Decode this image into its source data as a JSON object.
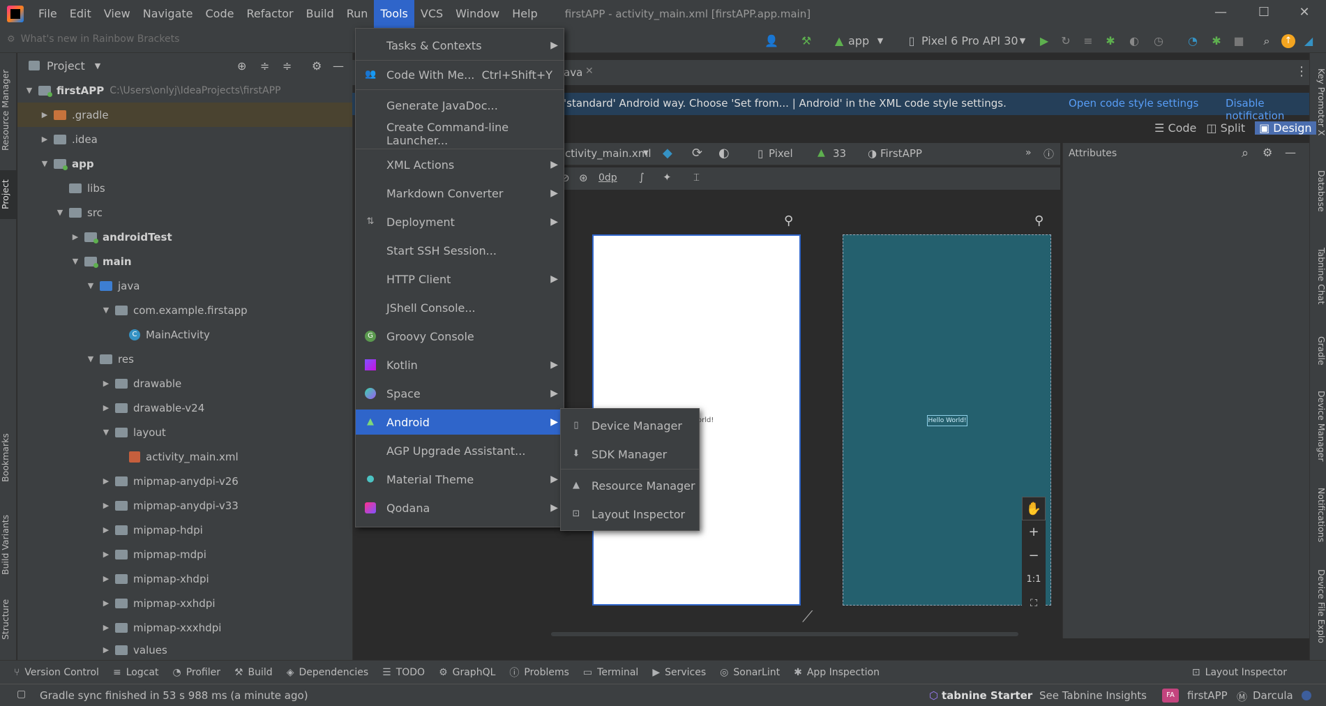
{
  "window": {
    "title": "firstAPP - activity_main.xml [firstAPP.app.main]",
    "minimize": "—",
    "maximize": "☐",
    "close": "✕"
  },
  "menubar": [
    "File",
    "Edit",
    "View",
    "Navigate",
    "Code",
    "Refactor",
    "Build",
    "Run",
    "Tools",
    "VCS",
    "Window",
    "Help"
  ],
  "navbar": {
    "whats_new": "What's new in Rainbow Brackets",
    "run_config": "app",
    "device": "Pixel 6 Pro API 30"
  },
  "left_stripe": [
    "Resource Manager",
    "Project",
    "Bookmarks",
    "Build Variants",
    "Structure"
  ],
  "right_stripe": [
    "Key Promoter X",
    "Database",
    "Tabnine Chat",
    "Gradle",
    "Device Manager",
    "Notifications",
    "Device File Explo"
  ],
  "project_panel": {
    "title": "Project",
    "tree": [
      {
        "label": "firstAPP",
        "extra": "C:\\Users\\onlyj\\IdeaProjects\\firstAPP",
        "bold": true
      },
      {
        "label": ".gradle"
      },
      {
        "label": ".idea"
      },
      {
        "label": "app",
        "bold": true
      },
      {
        "label": "libs"
      },
      {
        "label": "src"
      },
      {
        "label": "androidTest",
        "bold": true
      },
      {
        "label": "main",
        "bold": true
      },
      {
        "label": "java"
      },
      {
        "label": "com.example.firstapp"
      },
      {
        "label": "MainActivity"
      },
      {
        "label": "res"
      },
      {
        "label": "drawable"
      },
      {
        "label": "drawable-v24"
      },
      {
        "label": "layout"
      },
      {
        "label": "activity_main.xml"
      },
      {
        "label": "mipmap-anydpi-v26"
      },
      {
        "label": "mipmap-anydpi-v33"
      },
      {
        "label": "mipmap-hdpi"
      },
      {
        "label": "mipmap-mdpi"
      },
      {
        "label": "mipmap-xhdpi"
      },
      {
        "label": "mipmap-xxhdpi"
      },
      {
        "label": "mipmap-xxxhdpi"
      },
      {
        "label": "values"
      }
    ]
  },
  "editor": {
    "tab_fragment": "ava",
    "notification": "'standard' Android way. Choose 'Set from... | Android' in the XML code style settings.",
    "notif_link1": "Open code style settings",
    "notif_link2": "Disable notification",
    "view_code": "Code",
    "view_split": "Split",
    "view_design": "Design",
    "file_select": "ctivity_main.xml",
    "device_select": "Pixel",
    "api_select": "33",
    "theme_select": "FirstAPP",
    "margin_value": "0dp",
    "attributes_title": "Attributes",
    "hello_light_fragment": "orld!",
    "hello_dark": "Hello World!",
    "zoom_in": "+",
    "zoom_out": "−",
    "zoom_reset": "1:1"
  },
  "tools_menu": [
    {
      "label": "Tasks & Contexts",
      "sub": true
    },
    {
      "label": "Code With Me...",
      "shortcut": "Ctrl+Shift+Y"
    },
    {
      "label": "Generate JavaDoc..."
    },
    {
      "label": "Create Command-line Launcher..."
    },
    {
      "label": "XML Actions",
      "sub": true
    },
    {
      "label": "Markdown Converter",
      "sub": true
    },
    {
      "label": "Deployment",
      "sub": true
    },
    {
      "label": "Start SSH Session..."
    },
    {
      "label": "HTTP Client",
      "sub": true
    },
    {
      "label": "JShell Console..."
    },
    {
      "label": "Groovy Console"
    },
    {
      "label": "Kotlin",
      "sub": true
    },
    {
      "label": "Space",
      "sub": true
    },
    {
      "label": "Android",
      "sub": true,
      "highlighted": true
    },
    {
      "label": "AGP Upgrade Assistant..."
    },
    {
      "label": "Material Theme",
      "sub": true
    },
    {
      "label": "Qodana",
      "sub": true
    }
  ],
  "android_submenu": [
    "Device Manager",
    "SDK Manager",
    "Resource Manager",
    "Layout Inspector"
  ],
  "bottom_tools": [
    "Version Control",
    "Logcat",
    "Profiler",
    "Build",
    "Dependencies",
    "TODO",
    "GraphQL",
    "Problems",
    "Terminal",
    "Services",
    "SonarLint",
    "App Inspection"
  ],
  "bottom_right_tool": "Layout Inspector",
  "status": {
    "message": "Gradle sync finished in 53 s 988 ms (a minute ago)",
    "tabnine": "tabnine Starter",
    "tabnine_insights": "See Tabnine Insights",
    "project_badge": "FA",
    "project": "firstAPP",
    "theme": "Darcula"
  },
  "colors": {
    "accent": "#2f65ca",
    "panel": "#3c3f41",
    "editor_bg": "#2b2b2b",
    "phone_dark": "#24606e",
    "notification_bg": "#253f59",
    "link": "#589df6"
  }
}
